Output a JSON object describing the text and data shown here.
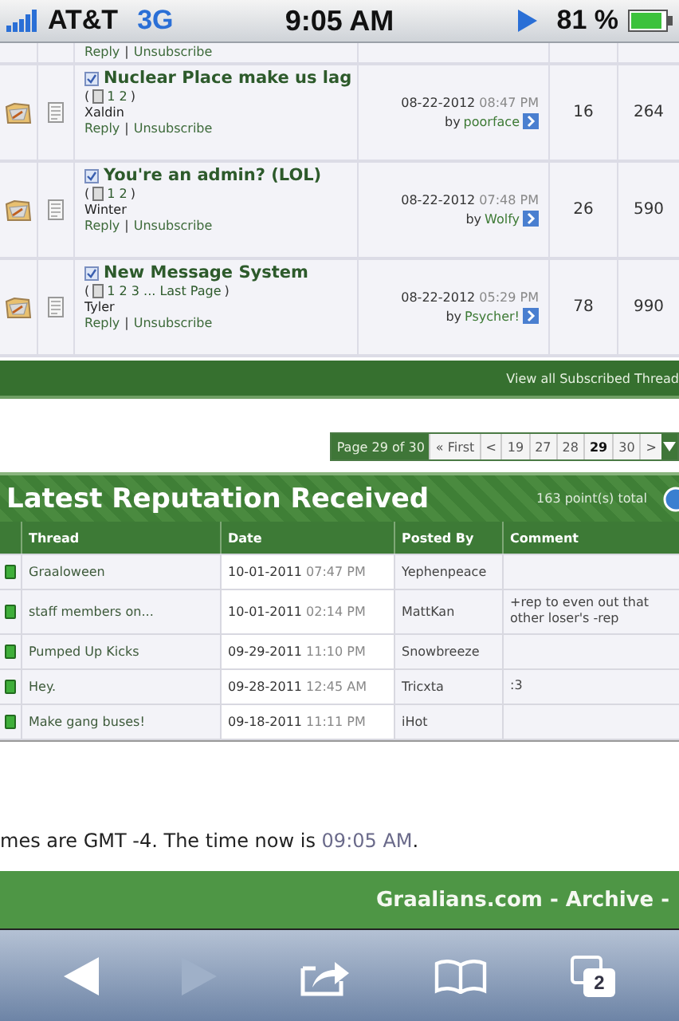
{
  "status_bar": {
    "carrier": "AT&T",
    "network": "3G",
    "time": "9:05 AM",
    "battery": "81 %"
  },
  "threads": {
    "partial_row": {
      "reply": "Reply",
      "separator": "|",
      "unsubscribe": "Unsubscribe"
    },
    "rows": [
      {
        "title": "Nuclear Place make us lag",
        "paren_open": "(",
        "pages": "1 2",
        "paren_close": ")",
        "author": "Xaldin",
        "reply": "Reply",
        "separator": "|",
        "unsubscribe": "Unsubscribe",
        "date": "08-22-2012",
        "time": "08:47 PM",
        "by_label": "by",
        "last_poster": "poorface",
        "replies": "16",
        "views": "264"
      },
      {
        "title": "You're an admin? (LOL)",
        "paren_open": "(",
        "pages": "1 2",
        "paren_close": ")",
        "author": "Winter",
        "reply": "Reply",
        "separator": "|",
        "unsubscribe": "Unsubscribe",
        "date": "08-22-2012",
        "time": "07:48 PM",
        "by_label": "by",
        "last_poster": "Wolfy",
        "replies": "26",
        "views": "590"
      },
      {
        "title": "New Message System",
        "paren_open": "(",
        "pages": "1 2 3 ... Last Page",
        "paren_close": ")",
        "author": "Tyler",
        "reply": "Reply",
        "separator": "|",
        "unsubscribe": "Unsubscribe",
        "date": "08-22-2012",
        "time": "05:29 PM",
        "by_label": "by",
        "last_poster": "Psycher!",
        "replies": "78",
        "views": "990"
      }
    ],
    "view_all": "View all Subscribed Thread"
  },
  "pagination": {
    "label": "Page 29 of 30",
    "pages": [
      {
        "label": "« First",
        "selected": false
      },
      {
        "label": "<",
        "selected": false
      },
      {
        "label": "19",
        "selected": false
      },
      {
        "label": "27",
        "selected": false
      },
      {
        "label": "28",
        "selected": false
      },
      {
        "label": "29",
        "selected": true
      },
      {
        "label": "30",
        "selected": false
      },
      {
        "label": ">",
        "selected": false
      }
    ]
  },
  "reputation": {
    "title": "Latest Reputation Received",
    "total": "163 point(s) total",
    "columns": [
      "Thread",
      "Date",
      "Posted By",
      "Comment"
    ],
    "rows": [
      {
        "thread": "Graaloween",
        "date": "10-01-2011",
        "time": "07:47 PM",
        "posted_by": "Yephenpeace"
      },
      {
        "thread": "staff members on...",
        "date": "10-01-2011",
        "time": "02:14 PM",
        "posted_by": "MattKan",
        "comment": "+rep to even out that other loser's -rep"
      },
      {
        "thread": "Pumped Up Kicks",
        "date": "09-29-2011",
        "time": "11:10 PM",
        "posted_by": "Snowbreeze"
      },
      {
        "thread": "Hey.",
        "date": "09-28-2011",
        "time": "12:45 AM",
        "posted_by": "Tricxta",
        "comment": ":3"
      },
      {
        "thread": "Make gang buses!",
        "date": "09-18-2011",
        "time": "11:11 PM",
        "posted_by": "iHot"
      }
    ]
  },
  "footer_note": {
    "text": "mes are GMT -4. The time now is ",
    "time": "09:05 AM",
    "end": "."
  },
  "bottom_bar": "Graalians.com - Archive -",
  "browser_toolbar": {
    "back_disabled": false,
    "forward_disabled": true,
    "tab_count": "2"
  }
}
